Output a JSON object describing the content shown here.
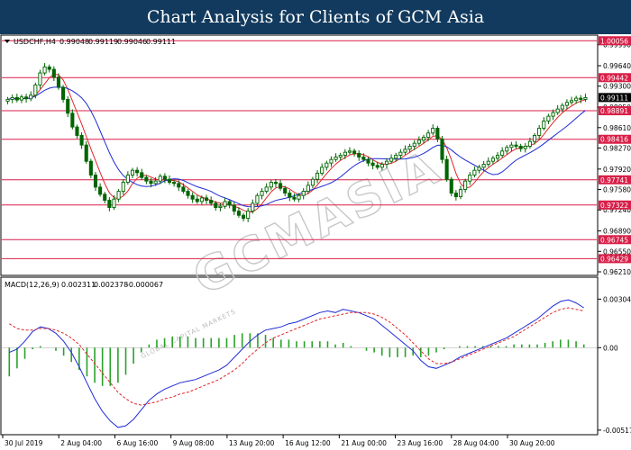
{
  "banner": {
    "title": "Chart Analysis for Clients of GCM Asia"
  },
  "colors": {
    "banner_bg": "#123a5e",
    "candle": "#006400",
    "fast_ma": "#e0262b",
    "slow_ma": "#1f2bd6",
    "level_line": "#d81f48",
    "level_label_bg": "#d81f48",
    "current_label_bg": "#000000",
    "macd_line": "#1f2bd6",
    "signal_line": "#e0262b",
    "histogram": "#2aa12a",
    "watermark": "#c8c8c8"
  },
  "icons": {
    "symbol_marker": "triangle-down-icon"
  },
  "watermark": {
    "main": "GCMASIA",
    "sub": "GLOBAL CAPITAL MARKETS"
  },
  "chart_data": [
    {
      "type": "candlestick",
      "symbol": "USDCHF,H4",
      "ohlc_header": {
        "open": "0.99048",
        "high": "0.99119",
        "low": "0.99046",
        "close": "0.99111"
      },
      "price_axis_ticks": [
        "0.99990",
        "0.99640",
        "0.99300",
        "0.98950",
        "0.98610",
        "0.98270",
        "0.97920",
        "0.97580",
        "0.97240",
        "0.96890",
        "0.96550",
        "0.96210"
      ],
      "ylim": [
        0.9615,
        1.0015
      ],
      "levels": [
        {
          "label": "1.00056",
          "value": 1.00056
        },
        {
          "label": "0.99442",
          "value": 0.99442
        },
        {
          "label": "0.98891",
          "value": 0.98891
        },
        {
          "label": "0.98416",
          "value": 0.98416
        },
        {
          "label": "0.97741",
          "value": 0.97741
        },
        {
          "label": "0.97322",
          "value": 0.97322
        },
        {
          "label": "0.96745",
          "value": 0.96745
        },
        {
          "label": "0.96429",
          "value": 0.96429
        }
      ],
      "current_price": {
        "label": "0.99111",
        "value": 0.99111
      },
      "x_tick_labels": [
        "30 Jul 2019",
        "2 Aug 04:00",
        "6 Aug 16:00",
        "9 Aug 08:00",
        "13 Aug 20:00",
        "16 Aug 12:00",
        "21 Aug 00:00",
        "23 Aug 16:00",
        "28 Aug 04:00",
        "30 Aug 20:00"
      ],
      "close_series": [
        0.9908,
        0.9911,
        0.9907,
        0.9912,
        0.9909,
        0.9915,
        0.9932,
        0.9952,
        0.9962,
        0.9958,
        0.9945,
        0.9928,
        0.9908,
        0.9885,
        0.9862,
        0.9848,
        0.9832,
        0.9805,
        0.9782,
        0.9762,
        0.975,
        0.974,
        0.9728,
        0.9742,
        0.9755,
        0.977,
        0.9782,
        0.979,
        0.9786,
        0.9778,
        0.9772,
        0.9768,
        0.9772,
        0.978,
        0.9775,
        0.977,
        0.9768,
        0.9762,
        0.9755,
        0.9748,
        0.9742,
        0.9738,
        0.9744,
        0.974,
        0.9735,
        0.9728,
        0.973,
        0.9738,
        0.9732,
        0.9722,
        0.9715,
        0.971,
        0.9722,
        0.9735,
        0.9748,
        0.9755,
        0.9762,
        0.977,
        0.9768,
        0.976,
        0.9752,
        0.9745,
        0.9742,
        0.9748,
        0.9755,
        0.9765,
        0.9775,
        0.9785,
        0.9795,
        0.9802,
        0.9808,
        0.9812,
        0.9815,
        0.982,
        0.9822,
        0.9818,
        0.9812,
        0.9808,
        0.9802,
        0.9798,
        0.9795,
        0.98,
        0.9805,
        0.981,
        0.9815,
        0.982,
        0.9825,
        0.983,
        0.9835,
        0.984,
        0.9845,
        0.9852,
        0.986,
        0.9842,
        0.9808,
        0.9775,
        0.9752,
        0.9746,
        0.9758,
        0.9772,
        0.9782,
        0.979,
        0.9795,
        0.98,
        0.9805,
        0.981,
        0.9815,
        0.9822,
        0.9828,
        0.9832,
        0.983,
        0.9826,
        0.983,
        0.9838,
        0.9848,
        0.986,
        0.9872,
        0.988,
        0.9886,
        0.9892,
        0.9898,
        0.9903,
        0.9906,
        0.991,
        0.9908,
        0.9911
      ]
    },
    {
      "type": "indicator",
      "name": "MACD(12,26,9)",
      "header_values": [
        "0.002311",
        "0.002378",
        "-0.000067"
      ],
      "axis_ticks": [
        "0.003041",
        "0.00",
        "-0.00517"
      ],
      "ylim": [
        -0.0054,
        0.0034
      ],
      "macd_series": [
        -0.0003,
        -0.0001,
        0.0004,
        0.001,
        0.0013,
        0.0012,
        0.0009,
        0.0004,
        -0.0003,
        -0.0012,
        -0.0022,
        -0.0032,
        -0.004,
        -0.0046,
        -0.005,
        -0.0049,
        -0.0045,
        -0.0039,
        -0.0033,
        -0.0029,
        -0.0026,
        -0.0024,
        -0.0022,
        -0.0021,
        -0.002,
        -0.0018,
        -0.0016,
        -0.0014,
        -0.0011,
        -0.0006,
        -0.0001,
        0.0004,
        0.0008,
        0.0011,
        0.0012,
        0.0013,
        0.0015,
        0.0016,
        0.0018,
        0.002,
        0.0022,
        0.0023,
        0.0022,
        0.0024,
        0.0023,
        0.0022,
        0.002,
        0.0018,
        0.0014,
        0.001,
        0.0006,
        0.0002,
        -0.0002,
        -0.0008,
        -0.0012,
        -0.0013,
        -0.0011,
        -0.0009,
        -0.0006,
        -0.0004,
        -0.0002,
        0.0,
        0.0002,
        0.0004,
        0.0006,
        0.0009,
        0.0012,
        0.0015,
        0.0018,
        0.0022,
        0.0026,
        0.0029,
        0.003,
        0.0028,
        0.0025
      ],
      "signal_series": [
        0.0015,
        0.0012,
        0.0011,
        0.0011,
        0.0012,
        0.0012,
        0.0011,
        0.0009,
        0.0006,
        0.0002,
        -0.0004,
        -0.001,
        -0.0016,
        -0.0022,
        -0.0028,
        -0.0032,
        -0.0035,
        -0.0036,
        -0.0035,
        -0.0034,
        -0.0032,
        -0.0031,
        -0.0029,
        -0.0028,
        -0.0026,
        -0.0024,
        -0.0022,
        -0.002,
        -0.0017,
        -0.0014,
        -0.001,
        -0.0005,
        -0.0001,
        0.0003,
        0.0006,
        0.0008,
        0.001,
        0.0012,
        0.0014,
        0.0016,
        0.0018,
        0.0019,
        0.002,
        0.0021,
        0.0022,
        0.0022,
        0.0022,
        0.0021,
        0.0019,
        0.0016,
        0.0012,
        0.0008,
        0.0003,
        -0.0002,
        -0.0007,
        -0.001,
        -0.001,
        -0.0009,
        -0.0007,
        -0.0005,
        -0.0003,
        -0.0001,
        0.0001,
        0.0003,
        0.0005,
        0.0007,
        0.001,
        0.0013,
        0.0016,
        0.0019,
        0.0022,
        0.0024,
        0.0025,
        0.0024,
        0.0023
      ]
    }
  ]
}
